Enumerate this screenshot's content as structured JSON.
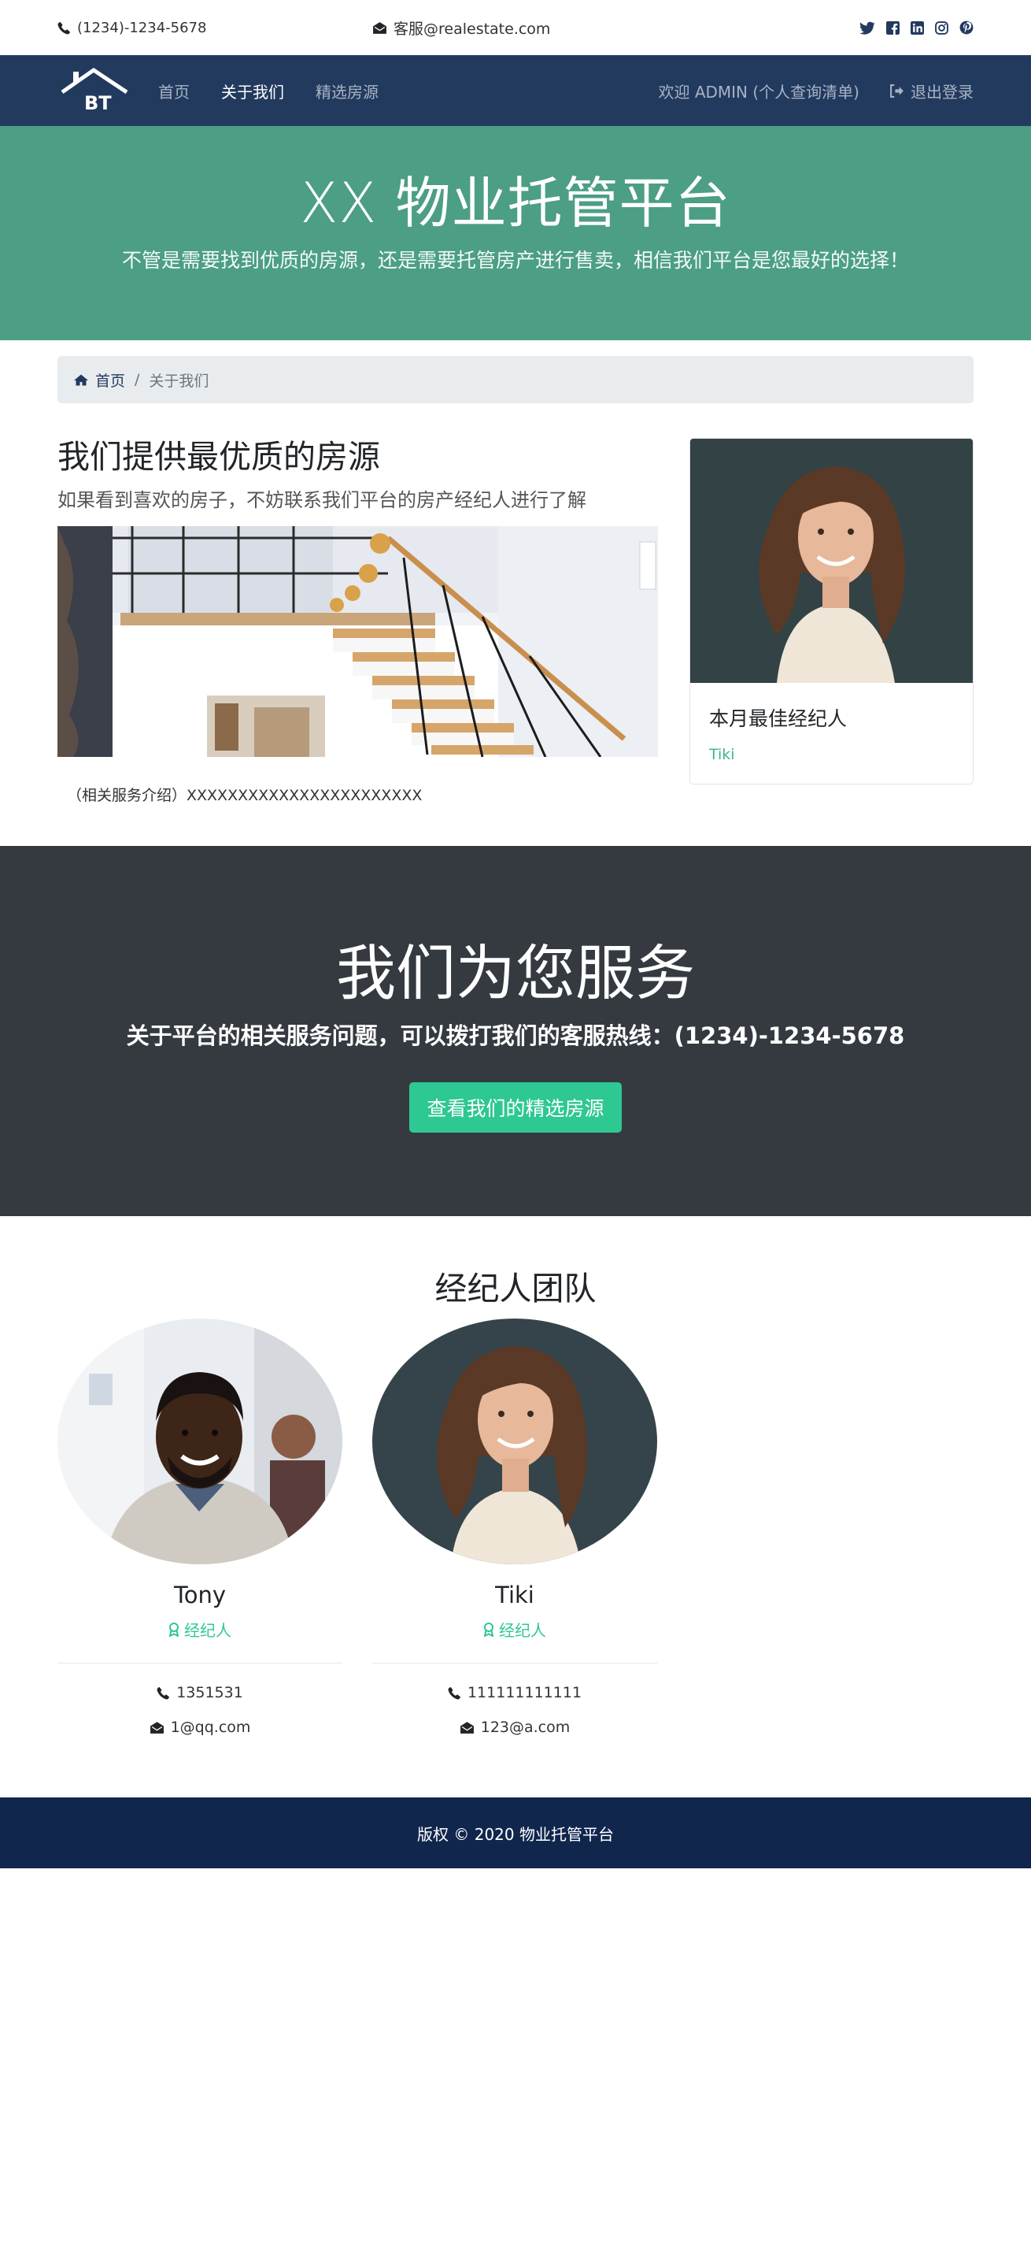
{
  "topbar": {
    "phone": "(1234)-1234-5678",
    "email": "客服@realestate.com",
    "social": [
      "twitter-icon",
      "facebook-icon",
      "linkedin-icon",
      "instagram-icon",
      "pinterest-icon"
    ]
  },
  "nav": {
    "logo_text": "BT",
    "links": [
      "首页",
      "关于我们",
      "精选房源"
    ],
    "active": "关于我们",
    "welcome": "欢迎 ADMIN (个人查询清单)",
    "logout": "退出登录"
  },
  "hero": {
    "title": "XX 物业托管平台",
    "subtitle": "不管是需要找到优质的房源，还是需要托管房产进行售卖，相信我们平台是您最好的选择！"
  },
  "breadcrumb": {
    "home": "首页",
    "current": "关于我们"
  },
  "about": {
    "heading": "我们提供最优质的房源",
    "lead": "如果看到喜欢的房子，不妨联系我们平台的房产经纪人进行了解",
    "intro": "（相关服务介绍）XXXXXXXXXXXXXXXXXXXXXXX",
    "card_title": "本月最佳经纪人",
    "card_name": "Tiki"
  },
  "service": {
    "title": "我们为您服务",
    "text": "关于平台的相关服务问题，可以拨打我们的客服热线：(1234)-1234-5678",
    "button": "查看我们的精选房源"
  },
  "team": {
    "title": "经纪人团队",
    "members": [
      {
        "name": "Tony",
        "role": "经纪人",
        "phone": "1351531",
        "email": "1@qq.com"
      },
      {
        "name": "Tiki",
        "role": "经纪人",
        "phone": "111111111111",
        "email": "123@a.com"
      }
    ]
  },
  "footer": {
    "text": "版权 © 2020 物业托管平台"
  },
  "colors": {
    "nav_bg": "#233a5f",
    "hero_bg": "#4c9e85",
    "band_bg": "#343a40",
    "accent": "#2ec892",
    "footer_bg": "#10264d"
  }
}
